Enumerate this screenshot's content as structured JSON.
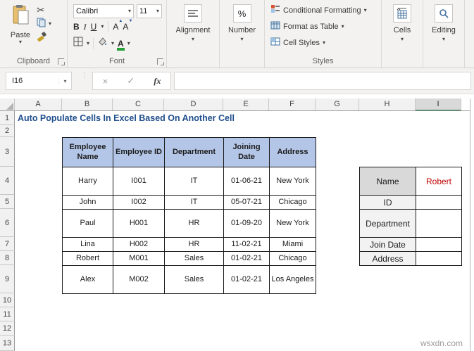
{
  "ribbon": {
    "clipboard": {
      "paste_label": "Paste",
      "group_label": "Clipboard"
    },
    "font": {
      "font_name": "Calibri",
      "font_size": "11",
      "bold": "B",
      "italic": "I",
      "underline": "U",
      "group_label": "Font"
    },
    "alignment": {
      "label": "Alignment"
    },
    "number": {
      "label": "Number",
      "percent_glyph": "%"
    },
    "styles": {
      "conditional_formatting": "Conditional Formatting",
      "format_as_table": "Format as Table",
      "cell_styles": "Cell Styles",
      "group_label": "Styles"
    },
    "cells": {
      "label": "Cells"
    },
    "editing": {
      "label": "Editing"
    }
  },
  "formula_bar": {
    "name_box": "I16",
    "fx_label": "fx",
    "cancel_glyph": "×",
    "enter_glyph": "✓",
    "formula": ""
  },
  "sheet": {
    "columns": [
      "A",
      "B",
      "C",
      "D",
      "E",
      "F",
      "G",
      "H",
      "I"
    ],
    "selected_column": "I",
    "row_numbers": [
      "1",
      "2",
      "3",
      "4",
      "5",
      "6",
      "7",
      "8",
      "9",
      "10",
      "11",
      "12",
      "13"
    ],
    "title": "Auto Populate Cells In Excel Based On Another Cell",
    "main_table": {
      "headers": [
        "Employee Name",
        "Employee ID",
        "Department",
        "Joining Date",
        "Address"
      ],
      "rows": [
        [
          "Harry",
          "I001",
          "IT",
          "01-06-21",
          "New York"
        ],
        [
          "John",
          "I002",
          "IT",
          "05-07-21",
          "Chicago"
        ],
        [
          "Paul",
          "H001",
          "HR",
          "01-09-20",
          "New York"
        ],
        [
          "Lina",
          "H002",
          "HR",
          "11-02-21",
          "Miami"
        ],
        [
          "Robert",
          "M001",
          "Sales",
          "01-02-21",
          "Chicago"
        ],
        [
          "Alex",
          "M002",
          "Sales",
          "01-02-21",
          "Los Angeles"
        ]
      ]
    },
    "lookup_table": {
      "rows": [
        {
          "label": "Name",
          "value": "Robert"
        },
        {
          "label": "ID",
          "value": ""
        },
        {
          "label": "Department",
          "value": ""
        },
        {
          "label": "Join Date",
          "value": ""
        },
        {
          "label": "Address",
          "value": ""
        }
      ]
    },
    "watermark": "wsxdn.com"
  },
  "colors": {
    "accent_green": "#217346",
    "font_color_swatch": "#27a035",
    "table_header_fill": "#b4c6e7",
    "title_blue": "#1f4e8c",
    "lookup_value_red": "#c00000"
  }
}
